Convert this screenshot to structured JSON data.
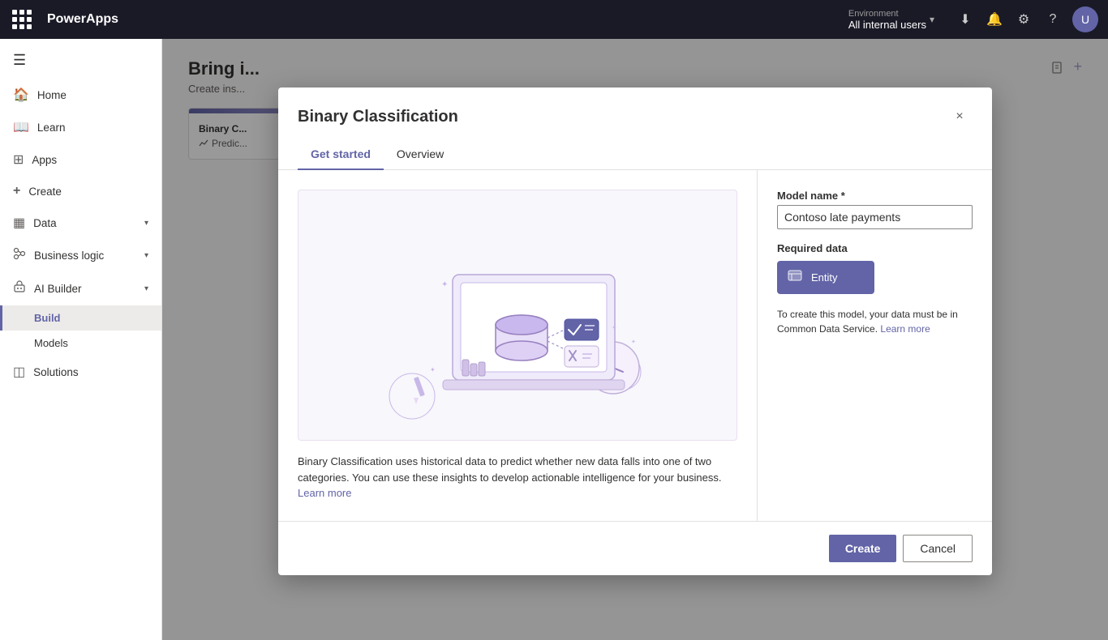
{
  "topbar": {
    "app_name": "PowerApps",
    "environment_label": "Environment",
    "environment_value": "All internal users",
    "chevron": "▾"
  },
  "sidebar": {
    "toggle_icon": "☰",
    "items": [
      {
        "id": "home",
        "label": "Home",
        "icon": "⌂",
        "has_chevron": false,
        "active": false
      },
      {
        "id": "learn",
        "label": "Learn",
        "icon": "📖",
        "has_chevron": false,
        "active": false
      },
      {
        "id": "apps",
        "label": "Apps",
        "icon": "⊞",
        "has_chevron": false,
        "active": false
      },
      {
        "id": "create",
        "label": "Create",
        "icon": "+",
        "has_chevron": false,
        "active": false
      },
      {
        "id": "data",
        "label": "Data",
        "icon": "▦",
        "has_chevron": true,
        "active": false
      },
      {
        "id": "business-logic",
        "label": "Business logic",
        "icon": "🔗",
        "has_chevron": true,
        "active": false
      },
      {
        "id": "ai-builder",
        "label": "AI Builder",
        "icon": "🤖",
        "has_chevron": true,
        "active": false
      },
      {
        "id": "build",
        "label": "Build",
        "icon": "",
        "active": true,
        "sub": true
      },
      {
        "id": "models",
        "label": "Models",
        "icon": "",
        "active": false,
        "sub": true
      },
      {
        "id": "solutions",
        "label": "Solutions",
        "icon": "◫",
        "has_chevron": false,
        "active": false
      }
    ]
  },
  "page": {
    "title": "Bring i...",
    "subtitle": "Create ins...",
    "card": {
      "tag": "Binary C...",
      "sub": "Predic..."
    }
  },
  "dialog": {
    "title": "Binary Classification",
    "close_label": "×",
    "tabs": [
      {
        "id": "get-started",
        "label": "Get started",
        "active": true
      },
      {
        "id": "overview",
        "label": "Overview",
        "active": false
      }
    ],
    "description": "Binary Classification uses historical data to predict whether new data falls into one of two categories. You can use these insights to develop actionable intelligence for your business.",
    "learn_more_desc": "Learn more",
    "model_name_label": "Model name *",
    "model_name_value": "Contoso late payments",
    "required_data_label": "Required data",
    "entity_label": "Entity",
    "cds_info": "To create this model, your data must be in Common Data Service.",
    "cds_learn_more": "Learn more",
    "create_label": "Create",
    "cancel_label": "Cancel"
  }
}
